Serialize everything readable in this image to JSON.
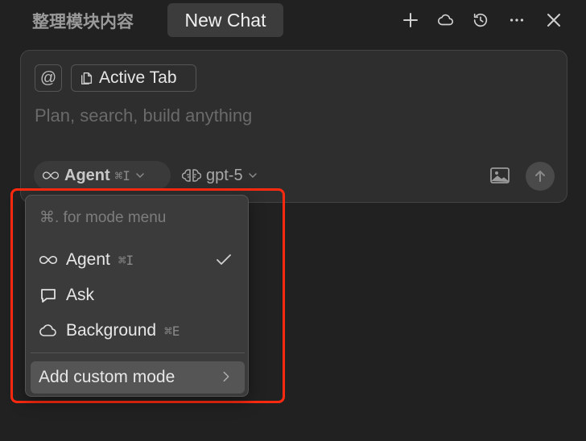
{
  "header": {
    "tab_inactive": "整理模块内容",
    "tab_active": "New Chat",
    "icons": [
      "plus-icon",
      "cloud-icon",
      "history-icon",
      "more-icon",
      "close-icon"
    ]
  },
  "composer": {
    "at_symbol": "@",
    "context_chip": "Active Tab",
    "placeholder": "Plan, search, build anything",
    "mode_label": "Agent",
    "mode_shortcut": "⌘I",
    "model_label": "gpt-5"
  },
  "mode_menu": {
    "hint": "⌘. for mode menu",
    "items": [
      {
        "label": "Agent",
        "shortcut": "⌘I",
        "icon": "infinity-icon",
        "selected": true
      },
      {
        "label": "Ask",
        "shortcut": "",
        "icon": "chat-bubble-icon",
        "selected": false
      },
      {
        "label": "Background",
        "shortcut": "⌘E",
        "icon": "cloud-icon",
        "selected": false
      }
    ],
    "custom_label": "Add custom mode"
  },
  "colors": {
    "background": "#212121",
    "highlight": "#ff2a10"
  }
}
